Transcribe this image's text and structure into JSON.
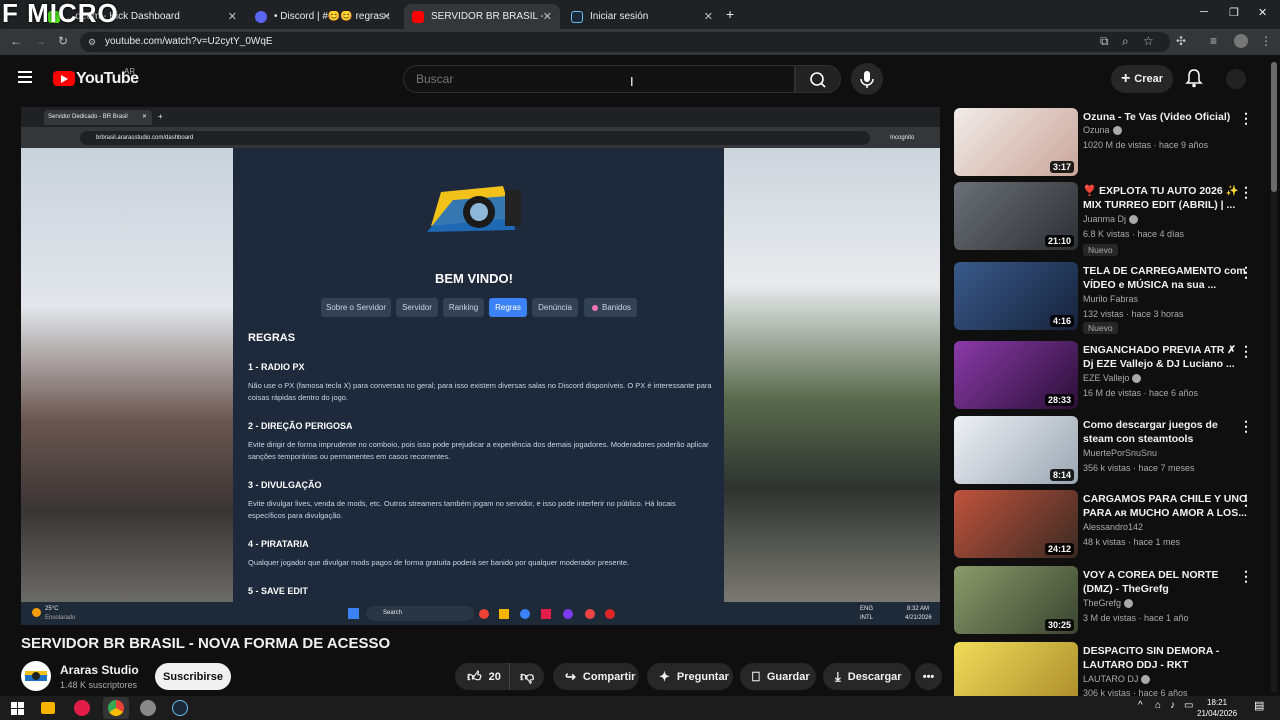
{
  "overlay": {
    "watermark": "F MICRO"
  },
  "browser": {
    "tabs": [
      {
        "title": "...deem - Kick Dashboard",
        "favicon_color": "#53fc18"
      },
      {
        "title": "• Discord | #😊😊 regras-servid...",
        "favicon_color": "#5865f2"
      },
      {
        "title": "SERVIDOR BR BRASIL - NOVA F...",
        "favicon_color": "#ff0000"
      },
      {
        "title": "Iniciar sesión",
        "favicon_color": "#1b2838"
      }
    ],
    "url": "youtube.com/watch?v=U2cytY_0WqE"
  },
  "youtube": {
    "logo_text": "YouTube",
    "country": "AR",
    "search_placeholder": "Buscar",
    "create_label": "Crear"
  },
  "video_frame": {
    "inner_tab": "Servidor Dedicado - BR Brasil",
    "inner_url": "brbrasil.ararasstudio.com/dashboard",
    "incognito": "Incognito",
    "welcome": "BEM VINDO!",
    "tabs": [
      "Sobre o Servidor",
      "Servidor",
      "Ranking",
      "Regras",
      "Denúncia",
      "Banidos"
    ],
    "active_tab": "Regras",
    "section_title": "REGRAS",
    "rules": [
      {
        "title": "1 - RADIO PX",
        "text": "Não use o PX (famosa tecla X) para conversas no geral; para isso existem diversas salas no Discord disponíveis. O PX é interessante para coisas rápidas dentro do jogo."
      },
      {
        "title": "2 - DIREÇÃO PERIGOSA",
        "text": "Evite dirigir de forma imprudente no comboio, pois isso pode prejudicar a experiência dos demais jogadores. Moderadores poderão aplicar sanções temporárias ou permanentes em casos recorrentes."
      },
      {
        "title": "3 - DIVULGAÇÃO",
        "text": "Evite divulgar lives, venda de mods, etc. Outros streamers também jogam no servidor, e isso pode interferir no público. Há locais específicos para divulgação."
      },
      {
        "title": "4 - PIRATARIA",
        "text": "Qualquer jogador que divulgar mods pagos de forma gratuita poderá ser banido por qualquer moderador presente."
      },
      {
        "title": "5 - SAVE EDIT",
        "text": ""
      }
    ],
    "weather_temp": "25°C",
    "weather_desc": "Ensolarado",
    "taskbar_search": "Search",
    "lang_1": "ENG",
    "lang_2": "INTL",
    "time": "8:32 AM",
    "date": "4/21/2026"
  },
  "video": {
    "title": "SERVIDOR BR BRASIL - NOVA FORMA DE ACESSO",
    "channel": "Araras Studio",
    "subscribers": "1.48 K suscriptores",
    "subscribe_label": "Suscribirse",
    "likes": "20",
    "share_label": "Compartir",
    "ask_label": "Preguntar",
    "save_label": "Guardar",
    "download_label": "Descargar"
  },
  "recommendations": [
    {
      "title": "Ozuna - Te Vas (Video Oficial)",
      "channel": "Ozuna",
      "meta": "1020 M de vistas · hace 9 años",
      "duration": "3:17",
      "verified": true,
      "badge": "",
      "thumb": "#e9e3df"
    },
    {
      "title": "❣️ EXPLOTA TU AUTO 2026 ✨ MIX TURREO EDIT (ABRIL) | ...",
      "channel": "Juanma Dj",
      "meta": "6.8 K vistas · hace 4 días",
      "duration": "21:10",
      "verified": true,
      "badge": "Nuevo",
      "thumb": "#4a4f55"
    },
    {
      "title": "TELA DE CARREGAMENTO com VÍDEO e MÚSICA na sua ...",
      "channel": "Murilo Fabras",
      "meta": "132 vistas · hace 3 horas",
      "duration": "4:16",
      "verified": false,
      "badge": "Nuevo",
      "thumb": "#2a3b55"
    },
    {
      "title": "ENGANCHADO PREVIA ATR ✗ Dj EZE Vallejo & DJ Luciano ...",
      "channel": "EZE Vallejo",
      "meta": "16 M de vistas · hace 6 años",
      "duration": "28:33",
      "verified": true,
      "badge": "",
      "thumb": "#5a2a6e"
    },
    {
      "title": "Como descargar juegos de steam con steamtools",
      "channel": "MuertePorSnuSnu",
      "meta": "356 k vistas · hace 7 meses",
      "duration": "8:14",
      "verified": false,
      "badge": "",
      "thumb": "#d8dde2"
    },
    {
      "title": "CARGAMOS PARA CHILE Y UNO PARA ᴀʀ MUCHO AMOR A LOS...",
      "channel": "Alessandro142",
      "meta": "48 k vistas · hace 1 mes",
      "duration": "24:12",
      "verified": false,
      "badge": "",
      "thumb": "#8a4a3a"
    },
    {
      "title": "VOY A COREA DEL NORTE (DMZ) - TheGrefg",
      "channel": "TheGrefg",
      "meta": "3 M de vistas · hace 1 año",
      "duration": "30:25",
      "verified": true,
      "badge": "",
      "thumb": "#6b7a5a"
    },
    {
      "title": "DESPACITO SIN DEMORA - LAUTARO DDJ - RKT",
      "channel": "LAUTARO DJ",
      "meta": "306 k vistas · hace 6 años",
      "duration": "",
      "verified": true,
      "badge": "",
      "thumb": "#e8d24a"
    }
  ],
  "system": {
    "time": "18:21",
    "date": "21/04/2026"
  }
}
